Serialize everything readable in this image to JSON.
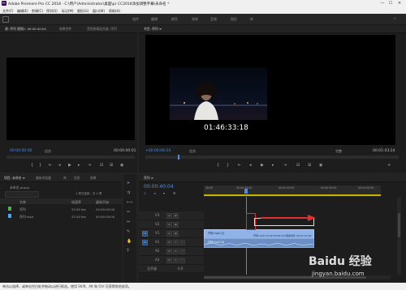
{
  "window": {
    "title": "Adobe Premiere Pro CC 2018 - C:\\用户\\Administrator\\桌面\\pr CC2018添加调整字幕\\未命名 *",
    "logo": "Pr",
    "controls": [
      "—",
      "☐",
      "✕"
    ]
  },
  "menu": [
    "文件(F)",
    "编辑(E)",
    "剪辑(C)",
    "序列(S)",
    "标记(M)",
    "图形(G)",
    "窗口(W)",
    "帮助(H)"
  ],
  "workspaces": [
    "组件",
    "编辑",
    "颜色",
    "效果",
    "音频",
    "图形",
    "库"
  ],
  "source_panel": {
    "tabs": [
      "源: 序列 视频1: 00:00:40:04",
      "效果控件",
      "音频剪辑混合器: 序列"
    ],
    "timecode_left": "00:00:00:00",
    "fit": "适合",
    "timecode_right": "00:00:00:01"
  },
  "program_panel": {
    "tab": "节目: 序列 ≡",
    "overlay_timecode": "01:46:33:18",
    "timecode_left": "+00:00:06:24",
    "fit": "适合",
    "quality": "完整",
    "timecode_right": "00:01:03:24"
  },
  "project_panel": {
    "tabs": [
      "项目: 未命名 ≡",
      "媒体浏览器",
      "库",
      "信息",
      "效果"
    ],
    "project_file": "未命名.prproj",
    "item_count": "1 项已选择，共 2 项",
    "columns": [
      "名称",
      "帧速率",
      "媒体开始"
    ],
    "items": [
      {
        "name": "序列",
        "fps": "25.00 fps",
        "start": "00:00:00:00",
        "color": "#4fb04f"
      },
      {
        "name": "序列.mp4",
        "fps": "25.00 fps",
        "start": "00:00:00:00",
        "color": "#5aa0e6"
      }
    ]
  },
  "timeline": {
    "tab": "序列 ≡",
    "timecode": "00:00:40:04",
    "ruler_labels": [
      "00:00",
      "00:00:15:00",
      "00:00:30:00",
      "00:00:45:00",
      "00:01:00:00"
    ],
    "tracks": [
      {
        "id": "V3",
        "kind": "video"
      },
      {
        "id": "V2",
        "kind": "video"
      },
      {
        "id": "V1",
        "kind": "video"
      },
      {
        "id": "A1",
        "kind": "audio"
      },
      {
        "id": "A2",
        "kind": "audio"
      },
      {
        "id": "A3",
        "kind": "audio"
      }
    ],
    "master_label": "主声道",
    "master_value": "0.0",
    "clips": {
      "v1_label": "开场.mp4 [V]",
      "v1_sub": "开场.mp4 [V]  00:00:06:24 持续时间: 00:01:03:24",
      "a1_label": "开场.mp4 [A]"
    }
  },
  "status": {
    "text": "单击以选择，或单击空白处并拖动以进行框选。使用 Shift、Alt 和 Ctrl 可获得其他选项。"
  },
  "watermark": {
    "brand": "Baidu 经验",
    "url": "jingyan.baidu.com"
  },
  "colors": {
    "accent_blue": "#4c8dea",
    "annotation_red": "#e23030",
    "clip_blue": "#8fb3e8",
    "timeline_yellow": "#c8b400"
  }
}
